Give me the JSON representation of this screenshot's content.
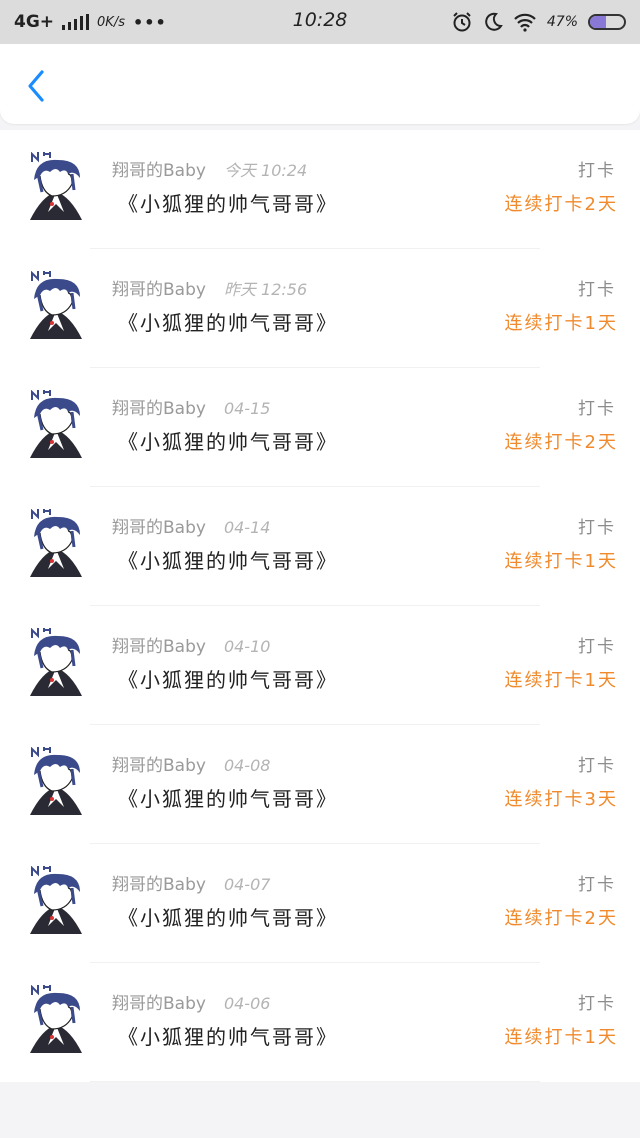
{
  "status_bar": {
    "network": "4G+",
    "speed": "0K/s",
    "dots": "•••",
    "time": "10:28",
    "battery_percent": "47%",
    "battery_level": 0.47,
    "icons": [
      "alarm-icon",
      "moon-icon",
      "wifi-icon",
      "battery-icon"
    ]
  },
  "nav": {
    "back_icon": "chevron-left-icon",
    "accent": "#1a8cff"
  },
  "rows": [
    {
      "user": "翔哥的Baby",
      "time": "今天 10:24",
      "title": "《小狐狸的帅气哥哥》",
      "action": "打卡",
      "streak": "连续打卡2天"
    },
    {
      "user": "翔哥的Baby",
      "time": "昨天 12:56",
      "title": "《小狐狸的帅气哥哥》",
      "action": "打卡",
      "streak": "连续打卡1天"
    },
    {
      "user": "翔哥的Baby",
      "time": "04-15",
      "title": "《小狐狸的帅气哥哥》",
      "action": "打卡",
      "streak": "连续打卡2天"
    },
    {
      "user": "翔哥的Baby",
      "time": "04-14",
      "title": "《小狐狸的帅气哥哥》",
      "action": "打卡",
      "streak": "连续打卡1天"
    },
    {
      "user": "翔哥的Baby",
      "time": "04-10",
      "title": "《小狐狸的帅气哥哥》",
      "action": "打卡",
      "streak": "连续打卡1天"
    },
    {
      "user": "翔哥的Baby",
      "time": "04-08",
      "title": "《小狐狸的帅气哥哥》",
      "action": "打卡",
      "streak": "连续打卡3天"
    },
    {
      "user": "翔哥的Baby",
      "time": "04-07",
      "title": "《小狐狸的帅气哥哥》",
      "action": "打卡",
      "streak": "连续打卡2天"
    },
    {
      "user": "翔哥的Baby",
      "time": "04-06",
      "title": "《小狐狸的帅气哥哥》",
      "action": "打卡",
      "streak": "连续打卡1天"
    }
  ],
  "colors": {
    "streak": "#f08a2c",
    "avatar_accent": "#3b4a8a"
  }
}
